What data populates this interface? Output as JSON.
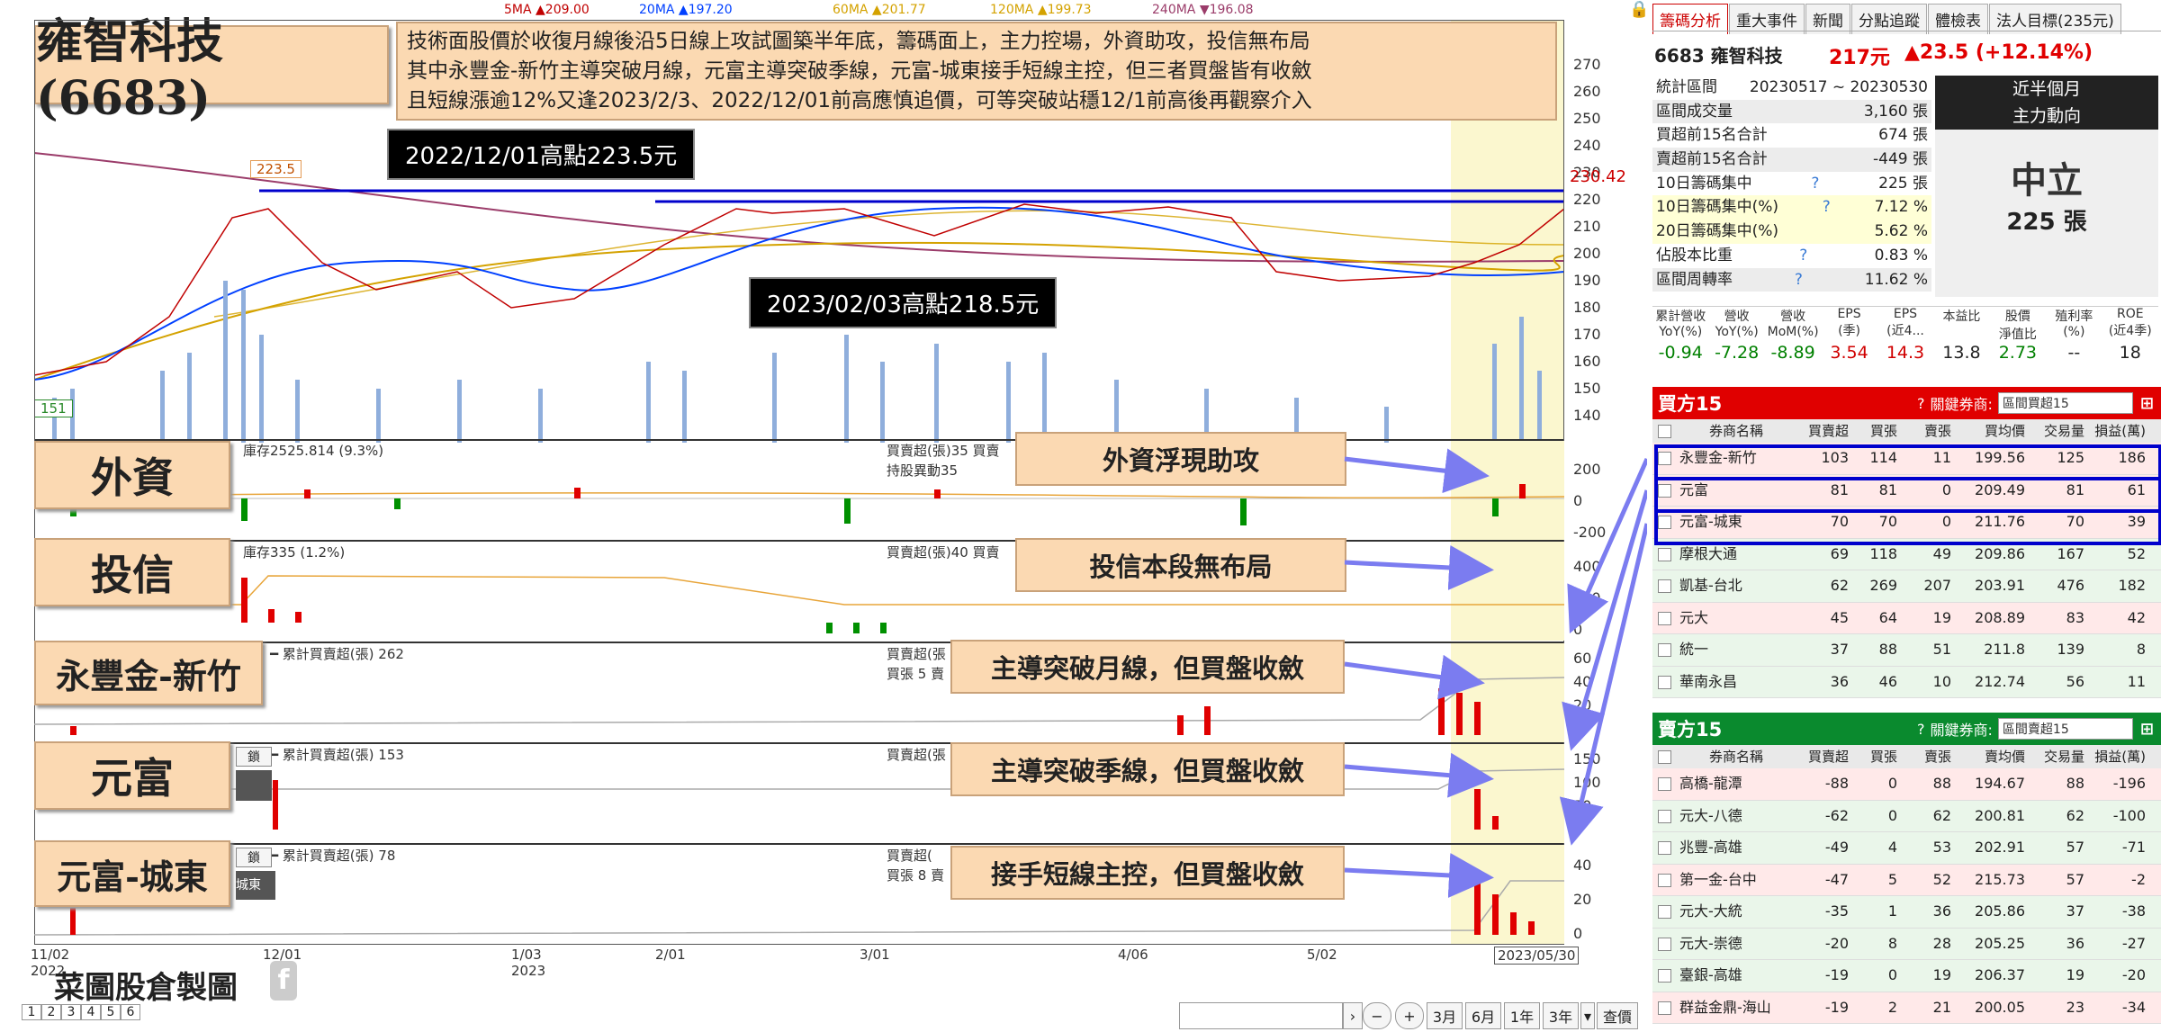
{
  "stock_title": "雍智科技(6683)",
  "description": [
    "技術面股價於收復月線後沿5日線上攻試圖築半年底，籌碼面上，主力控場，外資助攻，投信無布局",
    "其中永豐金-新竹主導突破月線，元富主導突破季線，元富-城東接手短線主控，但三者買盤皆有收斂",
    "且短線漲逾12%又逢2023/2/3、2022/12/01前高應慎追價，可等突破站穩12/1前高後再觀察介入"
  ],
  "ma_legend": [
    {
      "text": "5MA ▲209.00",
      "color": "#c00000"
    },
    {
      "text": "20MA ▲197.20",
      "color": "#0040ff"
    },
    {
      "text": "60MA ▲201.77",
      "color": "#d4a200"
    },
    {
      "text": "120MA ▲199.73",
      "color": "#d4a200"
    },
    {
      "text": "240MA ▼196.08",
      "color": "#9b3c6a"
    }
  ],
  "highlight_labels": {
    "high1": "2022/12/01高點223.5元",
    "high2": "2023/02/03高點218.5元",
    "tag_high": "223.5",
    "tag_low": "151",
    "last_price": "230.42"
  },
  "price_axis": [
    "270",
    "260",
    "250",
    "240",
    "230",
    "220",
    "210",
    "200",
    "190",
    "180",
    "170",
    "160",
    "150",
    "140"
  ],
  "side_labels": {
    "foreign": "外資",
    "trust": "投信",
    "broker1": "永豐金-新竹",
    "broker2": "元富",
    "broker3": "元富-城東"
  },
  "pane_titles": {
    "foreign": "庫存2525.814 (9.3%)",
    "foreign_r1": "買賣超(張)35 買賣",
    "foreign_r2": "持股異動35",
    "trust": "庫存335 (1.2%)",
    "trust_r1": "買賣超(張)40 買賣",
    "broker1": "━ 累計買賣超(張) 262",
    "broker1_r1": "買賣超(張",
    "broker1_r2": "買張 5 賣",
    "broker2": "━ 累計買賣超(張) 153",
    "broker2_r1": "買賣超(張",
    "broker3": "━ 累計買賣超(張) 78",
    "broker3_r1": "買賣超(",
    "broker3_r2": "買張 8 賣",
    "broker2_btn": "鎖",
    "broker3_btn": "鎖",
    "broker3_sub": "城東"
  },
  "pane_axes": {
    "foreign": [
      "200",
      "0",
      "-200"
    ],
    "trust": [
      "400",
      "200",
      "0"
    ],
    "broker1": [
      "60",
      "40",
      "20",
      "0"
    ],
    "broker2": [
      "150",
      "100",
      "50",
      "0"
    ],
    "broker3": [
      "40",
      "20",
      "0"
    ]
  },
  "callouts": {
    "foreign": "外資浮現助攻",
    "trust": "投信本段無布局",
    "broker1": "主導突破月線，但買盤收斂",
    "broker2": "主導突破季線，但買盤收斂",
    "broker3": "接手短線主控，但買盤收斂"
  },
  "x_axis": [
    {
      "label": "11/02",
      "sub": "2022"
    },
    {
      "label": "12/01",
      "sub": ""
    },
    {
      "label": "1/03",
      "sub": "2023"
    },
    {
      "label": "2/01",
      "sub": ""
    },
    {
      "label": "3/01",
      "sub": ""
    },
    {
      "label": "4/06",
      "sub": ""
    },
    {
      "label": "5/02",
      "sub": ""
    },
    {
      "label": "2023/05/30",
      "sub": ""
    }
  ],
  "watermark": "菜圖股倉製圖",
  "page_tabs": [
    "1",
    "2",
    "3",
    "4",
    "5",
    "6"
  ],
  "bottom_controls": {
    "zoom_out": "−",
    "zoom_in": "+",
    "periods": [
      "3月",
      "6月",
      "1年",
      "3年"
    ],
    "query": "查價"
  },
  "panel": {
    "tabs": [
      "籌碼分析",
      "重大事件",
      "新聞",
      "分點追蹤",
      "體檢表",
      "法人目標(235元)"
    ],
    "stock_name": "6683 雍智科技",
    "price": "217元",
    "change": "▲23.5 (+12.14%)",
    "stats": [
      {
        "k": "統計區間",
        "v": "20230517 ~ 20230530"
      },
      {
        "k": "區間成交量",
        "v": "3,160 張"
      },
      {
        "k": "買超前15名合計",
        "v": "674 張"
      },
      {
        "k": "賣超前15名合計",
        "v": "-449 張"
      },
      {
        "k": "10日籌碼集中",
        "v": "225 張",
        "q": "?"
      },
      {
        "k": "10日籌碼集中(%)",
        "v": "7.12 %",
        "q": "?"
      },
      {
        "k": "20日籌碼集中(%)",
        "v": "5.62 %"
      },
      {
        "k": "佔股本比重",
        "v": "0.83 %",
        "q": "?"
      },
      {
        "k": "區間周轉率",
        "v": "11.62 %",
        "q": "?"
      }
    ],
    "trend_title": "近半個月",
    "trend_sub": "主力動向",
    "trend_value": "中立",
    "trend_qty": "225 張",
    "fin_headers": [
      "累計營收\nYoY(%)",
      "營收\nYoY(%)",
      "營收\nMoM(%)",
      "EPS\n(季)",
      "EPS\n(近4...",
      "本益比",
      "股價\n淨值比",
      "殖利率\n(%)",
      "ROE\n(近4季)"
    ],
    "fin_values": [
      {
        "v": "-0.94",
        "c": "#008000"
      },
      {
        "v": "-7.28",
        "c": "#008000"
      },
      {
        "v": "-8.89",
        "c": "#008000"
      },
      {
        "v": "3.54",
        "c": "#d00000"
      },
      {
        "v": "14.3",
        "c": "#d00000"
      },
      {
        "v": "13.8",
        "c": "#222"
      },
      {
        "v": "2.73",
        "c": "#008000"
      },
      {
        "v": "--",
        "c": "#222"
      },
      {
        "v": "18",
        "c": "#222"
      }
    ],
    "buy_title": "買方15",
    "buy_key": "關鍵券商:",
    "buy_dd": "區間買超15",
    "sell_title": "賣方15",
    "sell_key": "關鍵券商:",
    "sell_dd": "區間賣超15",
    "buy_cols": [
      "券商名稱",
      "買賣超",
      "買張",
      "賣張",
      "買均價",
      "交易量",
      "損益(萬)"
    ],
    "sell_cols": [
      "券商名稱",
      "買賣超",
      "買張",
      "賣張",
      "賣均價",
      "交易量",
      "損益(萬)"
    ],
    "buy_rows": [
      [
        "永豐金-新竹",
        "103",
        "114",
        "11",
        "199.56",
        "125",
        "186"
      ],
      [
        "元富",
        "81",
        "81",
        "0",
        "209.49",
        "81",
        "61"
      ],
      [
        "元富-城東",
        "70",
        "70",
        "0",
        "211.76",
        "70",
        "39"
      ],
      [
        "摩根大通",
        "69",
        "118",
        "49",
        "209.86",
        "167",
        "52"
      ],
      [
        "凱基-台北",
        "62",
        "269",
        "207",
        "203.91",
        "476",
        "182"
      ],
      [
        "元大",
        "45",
        "64",
        "19",
        "208.89",
        "83",
        "42"
      ],
      [
        "統一",
        "37",
        "88",
        "51",
        "211.8",
        "139",
        "8"
      ],
      [
        "華南永昌",
        "36",
        "46",
        "10",
        "212.74",
        "56",
        "11"
      ]
    ],
    "sell_rows": [
      [
        "高橋-龍潭",
        "-88",
        "0",
        "88",
        "194.67",
        "88",
        "-196"
      ],
      [
        "元大-八德",
        "-62",
        "0",
        "62",
        "200.81",
        "62",
        "-100"
      ],
      [
        "兆豐-高雄",
        "-49",
        "4",
        "53",
        "202.91",
        "57",
        "-71"
      ],
      [
        "第一金-台中",
        "-47",
        "5",
        "52",
        "215.73",
        "57",
        "-2"
      ],
      [
        "元大-大統",
        "-35",
        "1",
        "36",
        "205.86",
        "37",
        "-38"
      ],
      [
        "元大-崇德",
        "-20",
        "8",
        "28",
        "205.25",
        "36",
        "-27"
      ],
      [
        "臺銀-高雄",
        "-19",
        "0",
        "19",
        "206.37",
        "19",
        "-20"
      ],
      [
        "群益金鼎-海山",
        "-19",
        "2",
        "21",
        "200.05",
        "23",
        "-34"
      ]
    ]
  }
}
